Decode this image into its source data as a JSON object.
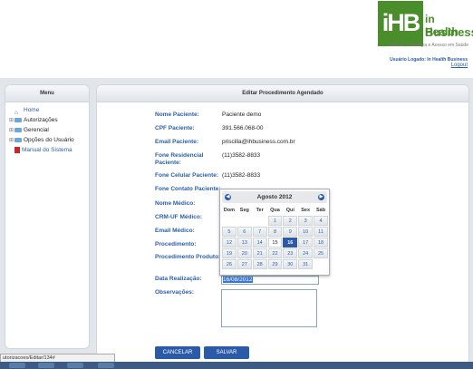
{
  "brand": {
    "mark": "iHB",
    "line1": "in Health",
    "line2": "Business",
    "tagline": "Gestão, Estratégia e Acesso em Saúde",
    "user": "Usuário Logado: In Health Business",
    "logout": "Logout"
  },
  "menu": {
    "title": "Menu",
    "items": [
      {
        "label": "Home",
        "icon": "home-icon"
      },
      {
        "label": "Autorizações",
        "icon": "folder-icon"
      },
      {
        "label": "Gerencial",
        "icon": "folder-icon"
      },
      {
        "label": "Opções do Usuário",
        "icon": "folder-icon"
      },
      {
        "label": "Manual do Sistema",
        "icon": "pdf-icon"
      }
    ]
  },
  "main": {
    "title": "Editar Procedimento Agendado",
    "fields": [
      {
        "label": "Nome Paciente:",
        "value": "Paciente demo"
      },
      {
        "label": "CPF Paciente:",
        "value": "391.566.068-00"
      },
      {
        "label": "Email Paciente:",
        "value": "priscilla@ihbusiness.com.br"
      },
      {
        "label": "Fone Residencial Paciente:",
        "value": "(11)3582-8833"
      },
      {
        "label": "Fone Celular Paciente:",
        "value": "(11)3582-8833"
      },
      {
        "label": "Fone Contato Paciente:",
        "value": ""
      },
      {
        "label": "Nome Médico:",
        "value": ""
      },
      {
        "label": "CRM-UF Médico:",
        "value": ""
      },
      {
        "label": "Email Médico:",
        "value": ""
      },
      {
        "label": "Procedimento:",
        "value": ""
      },
      {
        "label": "Procedimento Produto:",
        "value": ""
      },
      {
        "label": "Data Realização:",
        "value": ""
      },
      {
        "label": "Observações:",
        "value": ""
      }
    ],
    "date_value": "16/08/2012",
    "cancel": "CANCELAR",
    "save": "SALVAR"
  },
  "calendar": {
    "month": "Agosto 2012",
    "prev": "◀",
    "next": "▶",
    "weekdays": [
      "Dom",
      "Seg",
      "Ter",
      "Qua",
      "Qui",
      "Sex",
      "Sáb"
    ],
    "weeks": [
      [
        "",
        "",
        "",
        "1",
        "2",
        "3",
        "4"
      ],
      [
        "5",
        "6",
        "7",
        "8",
        "9",
        "10",
        "11"
      ],
      [
        "12",
        "13",
        "14",
        "15",
        "16",
        "17",
        "18"
      ],
      [
        "19",
        "20",
        "21",
        "22",
        "23",
        "24",
        "25"
      ],
      [
        "26",
        "27",
        "28",
        "29",
        "30",
        "31",
        ""
      ]
    ],
    "selected": "16",
    "today": "15"
  },
  "status": {
    "url": "utorizacoes/Editar/134#"
  }
}
